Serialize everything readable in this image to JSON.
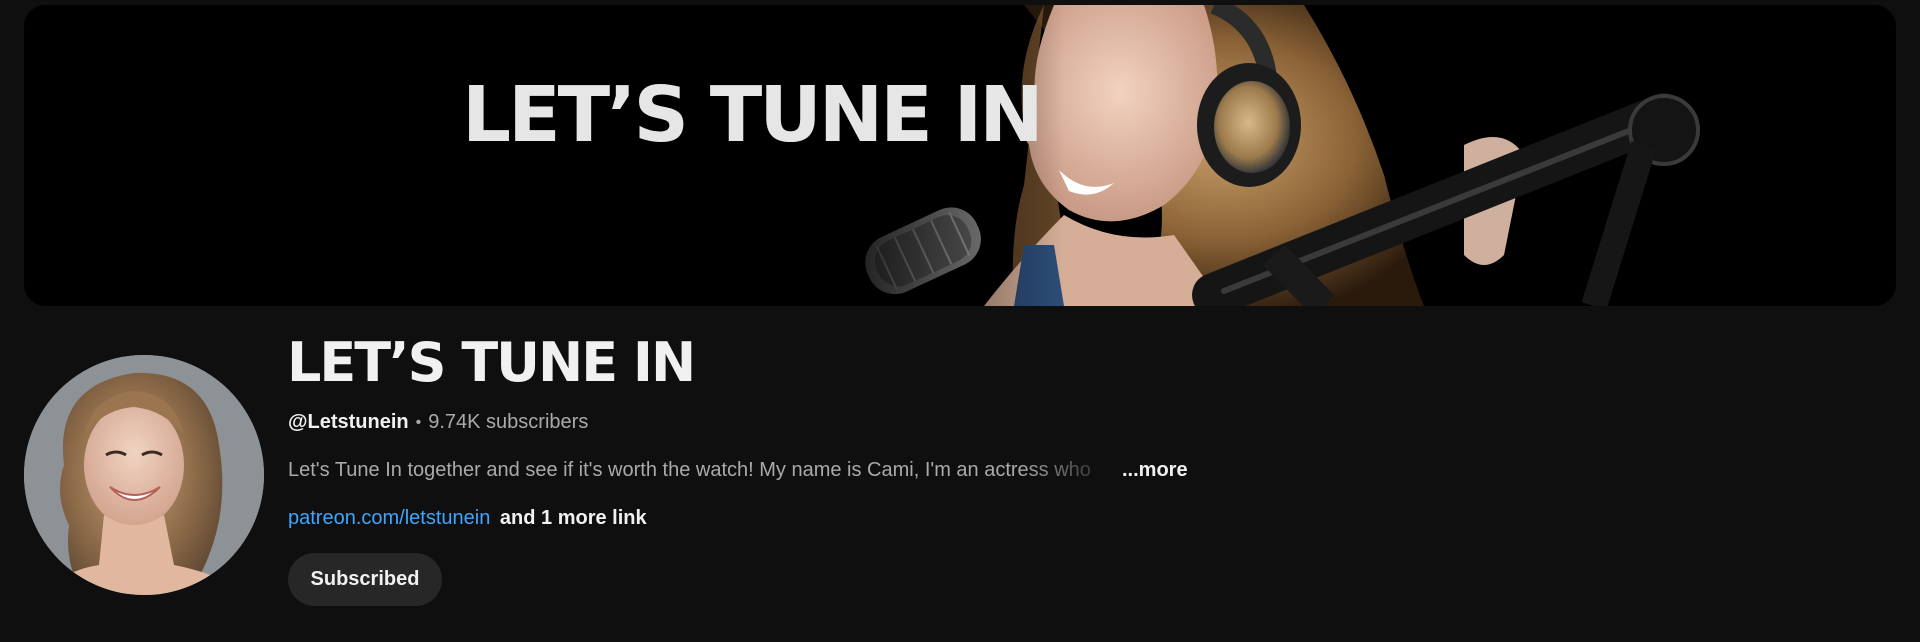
{
  "banner": {
    "text": "LET’S TUNE IN",
    "image": "woman-singing-with-headphones-and-microphone"
  },
  "channel": {
    "title": "LET’S TUNE IN",
    "avatar": "woman-smiling-portrait",
    "handle": "@Letstunein",
    "separator": "•",
    "subscribers": "9.74K subscribers",
    "description": "Let's Tune In together and see if it's worth the watch! My name is Cami, I'm an actress who",
    "more_label": "...more",
    "link_text": "patreon.com/letstunein",
    "more_links": "and 1 more link",
    "subscribe_label": "Subscribed"
  },
  "colors": {
    "background": "#0f0f0f",
    "link": "#3ea6ff",
    "secondary_text": "#aaaaaa",
    "button_bg": "#272727"
  }
}
